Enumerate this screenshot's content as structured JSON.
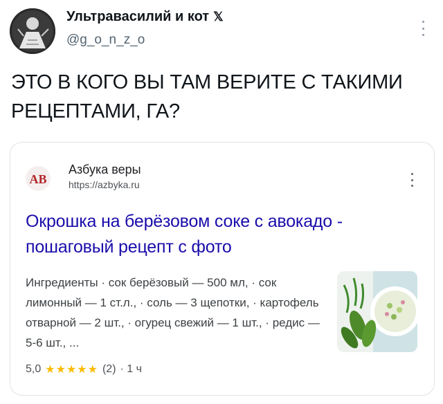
{
  "tweet": {
    "author": {
      "display_name": "Ультравасилий и кот",
      "badge_icon": "x-logo-icon",
      "handle": "@g_o_n_z_o"
    },
    "text": "ЭТО В КОГО ВЫ ТАМ ВЕРИТЕ С ТАКИМИ РЕЦЕПТАМИ, ГА?"
  },
  "search_card": {
    "site_name": "Азбука веры",
    "site_url": "https://azbyka.ru",
    "logo_letters": "АВ",
    "title": "Окрошка на берёзовом соке с авокадо - пошаговый рецепт с фото",
    "snippet": "Ингредиенты · сок берёзовый — 500 мл, · сок лимонный — 1 ст.л., · соль — 3 щепотки, · картофель отварной — 2 шт., · огурец свежий — 1 шт., · редис — 5-6 шт., ...",
    "rating": {
      "value": "5,0",
      "stars": "★★★★★",
      "count": "(2)",
      "age": "· 1 ч"
    }
  },
  "colors": {
    "link": "#1a0dab",
    "star": "#fbbc04",
    "secondary_text": "#536471",
    "logo_red": "#b3262b"
  }
}
